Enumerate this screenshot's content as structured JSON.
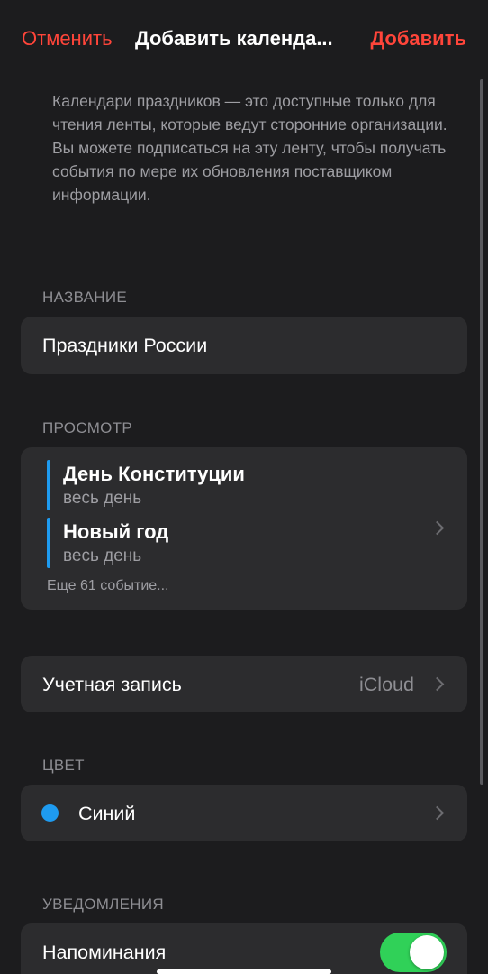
{
  "nav": {
    "cancel_label": "Отменить",
    "title": "Добавить календа...",
    "add_label": "Добавить"
  },
  "info_text": "Календари праздников — это доступные только для чтения ленты, которые ведут сторонние организации. Вы можете подписаться на эту ленту, чтобы получать события по мере их обновления поставщиком информации.",
  "name_section": {
    "header": "НАЗВАНИЕ",
    "value": "Праздники России"
  },
  "preview_section": {
    "header": "ПРОСМОТР",
    "events": [
      {
        "title": "День Конституции",
        "subtitle": "весь день"
      },
      {
        "title": "Новый год",
        "subtitle": "весь день"
      }
    ],
    "more_label": "Еще 61 событие..."
  },
  "account_row": {
    "label": "Учетная запись",
    "value": "iCloud"
  },
  "color_section": {
    "header": "ЦВЕТ",
    "value": "Синий",
    "dot_color": "#1e9bf0"
  },
  "notifications_section": {
    "header": "УВЕДОМЛЕНИЯ",
    "reminders_label": "Напоминания",
    "reminders_on": true
  },
  "colors": {
    "accent": "#ff453a",
    "toggle_on": "#30d158",
    "event_bar": "#1e9bf0"
  }
}
